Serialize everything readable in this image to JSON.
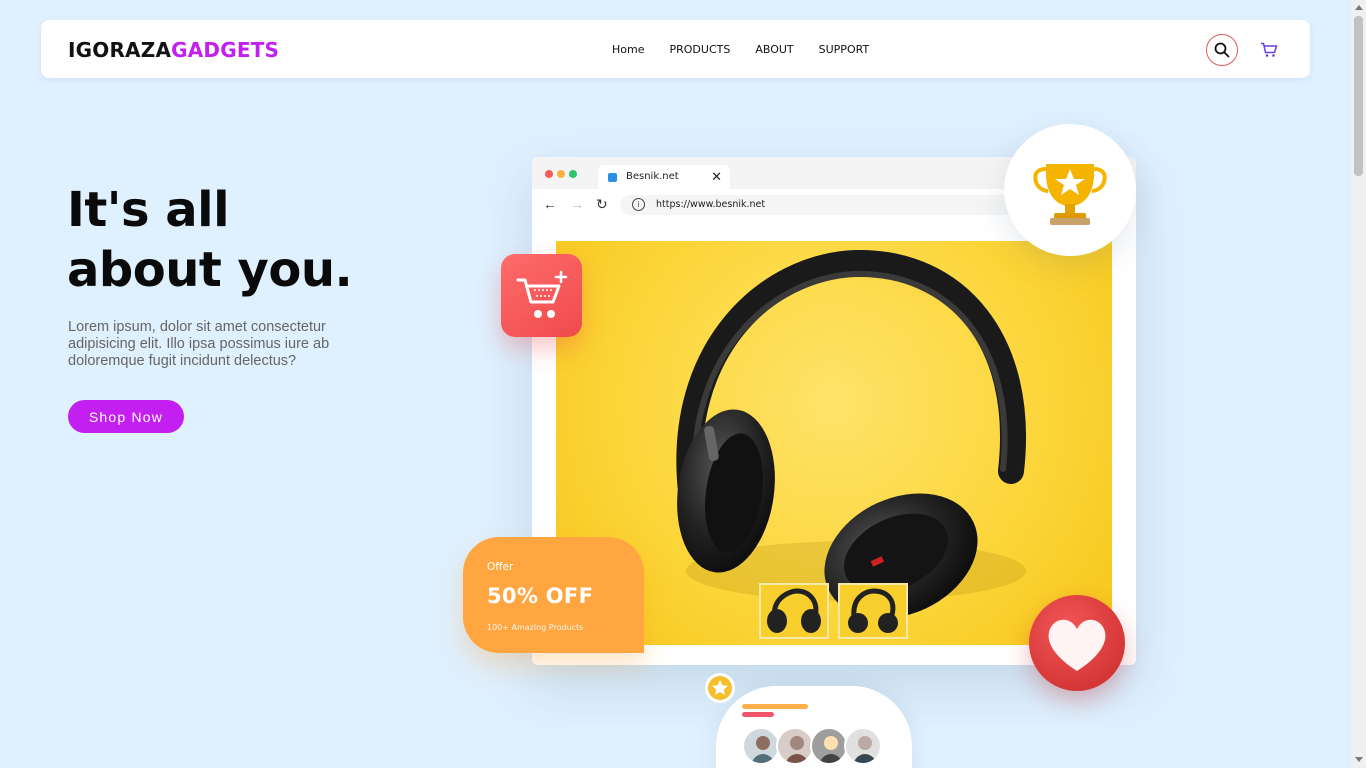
{
  "header": {
    "logo_part1": "IGORAZA",
    "logo_part2": "GADGETS",
    "nav": [
      "Home",
      "PRODUCTS",
      "ABOUT",
      "SUPPORT"
    ],
    "search_icon": "search-icon",
    "cart_icon": "shopping-cart-icon"
  },
  "hero": {
    "title_line1": "It's all",
    "title_line2": "about you.",
    "description": "Lorem ipsum, dolor sit amet consectetur adipisicing elit. Illo ipsa possimus iure ab doloremque fugit incidunt delectus?",
    "cta": "Shop Now"
  },
  "illustration": {
    "tab_title": "Besnik.net",
    "url": "https://www.besnik.net",
    "offer_label": "Offer",
    "offer_value": "50% OFF",
    "offer_sub": "100+ Amazing Products"
  },
  "colors": {
    "background": "#dff0fe",
    "accent": "#c21ff0",
    "offer": "#ffa640",
    "cart_badge": "#ef4b4b",
    "viewport": "#fcd63b"
  }
}
